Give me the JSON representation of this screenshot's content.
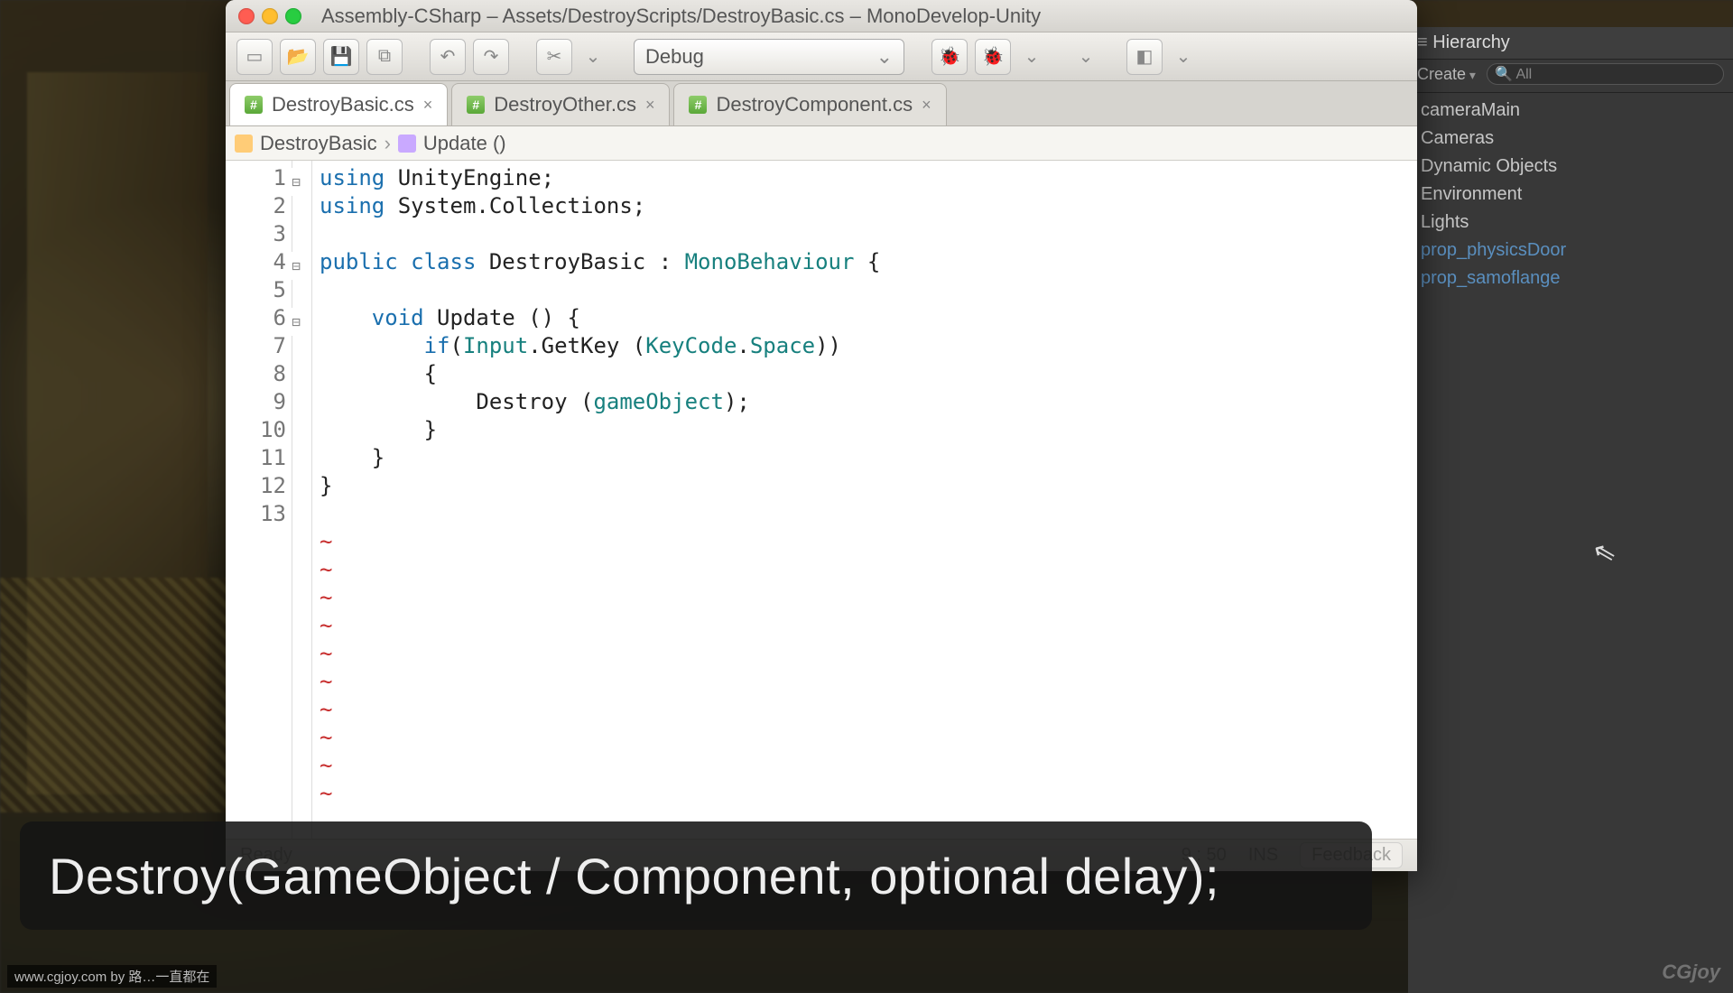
{
  "window": {
    "title": "Assembly-CSharp – Assets/DestroyScripts/DestroyBasic.cs – MonoDevelop-Unity"
  },
  "toolbar": {
    "config_label": "Debug"
  },
  "tabs": [
    {
      "label": "DestroyBasic.cs",
      "active": true
    },
    {
      "label": "DestroyOther.cs",
      "active": false
    },
    {
      "label": "DestroyComponent.cs",
      "active": false
    }
  ],
  "breadcrumb": {
    "class": "DestroyBasic",
    "member": "Update ()"
  },
  "code": {
    "lines": [
      {
        "n": 1,
        "fold": true
      },
      {
        "n": 2
      },
      {
        "n": 3
      },
      {
        "n": 4,
        "fold": true
      },
      {
        "n": 5
      },
      {
        "n": 6,
        "fold": true
      },
      {
        "n": 7
      },
      {
        "n": 8
      },
      {
        "n": 9
      },
      {
        "n": 10
      },
      {
        "n": 11
      },
      {
        "n": 12
      },
      {
        "n": 13
      }
    ],
    "l1_kw1": "using",
    "l1_rest": " UnityEngine;",
    "l2_kw1": "using",
    "l2_rest": " System.Collections;",
    "l4_kw1": "public",
    "l4_kw2": "class",
    "l4_name": " DestroyBasic : ",
    "l4_type": "MonoBehaviour",
    "l4_rest": " {",
    "l6_kw1": "void",
    "l6_rest": " Update () {",
    "l7_kw1": "if",
    "l7_a": "(",
    "l7_type1": "Input",
    "l7_b": ".GetKey (",
    "l7_type2": "KeyCode",
    "l7_c": ".",
    "l7_type3": "Space",
    "l7_d": "))",
    "l8": "        {",
    "l9_a": "            Destroy (",
    "l9_type": "gameObject",
    "l9_b": ");",
    "l10": "        }",
    "l11": "    }",
    "l12": "}",
    "tilde": "~"
  },
  "statusbar": {
    "left": "Ready",
    "pos": "9 : 50",
    "mode": "INS",
    "feedback": "Feedback"
  },
  "hierarchy": {
    "title": "Hierarchy",
    "create": "Create",
    "search_placeholder": "All",
    "items": [
      {
        "label": "cameraMain",
        "blue": false
      },
      {
        "label": "Cameras",
        "blue": false
      },
      {
        "label": "Dynamic Objects",
        "blue": false
      },
      {
        "label": "Environment",
        "blue": false
      },
      {
        "label": "Lights",
        "blue": false
      },
      {
        "label": "prop_physicsDoor",
        "blue": true
      },
      {
        "label": "prop_samoflange",
        "blue": true
      }
    ]
  },
  "caption": "Destroy(GameObject / Component, optional delay);",
  "credit": "www.cgjoy.com by 路…一直都在",
  "logo": "CGjoy"
}
